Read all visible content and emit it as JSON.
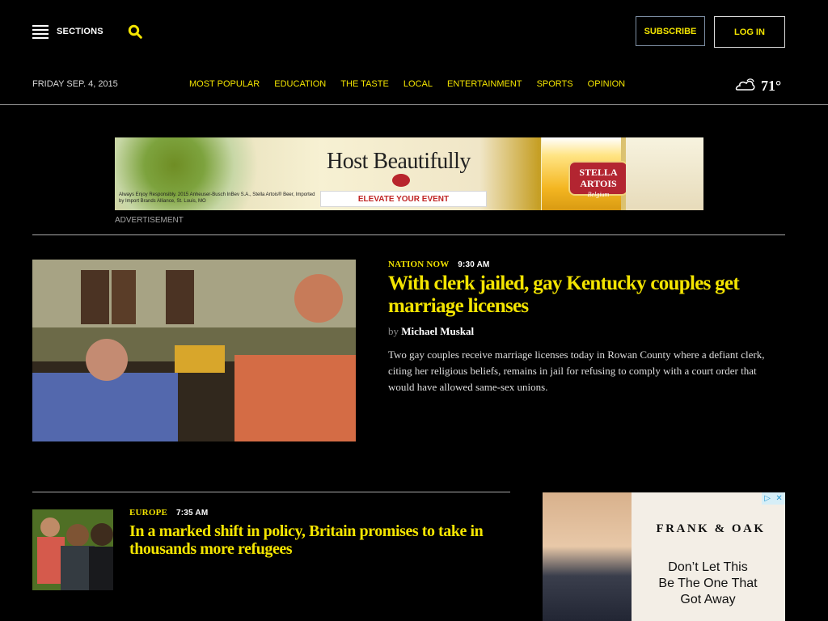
{
  "header": {
    "sections_label": "SECTIONS",
    "subscribe_label": "SUBSCRIBE",
    "login_label": "LOG IN"
  },
  "nav": {
    "date": "FRIDAY SEP. 4, 2015",
    "links": [
      "MOST POPULAR",
      "EDUCATION",
      "THE TASTE",
      "LOCAL",
      "ENTERTAINMENT",
      "SPORTS",
      "OPINION"
    ],
    "temperature": "71°",
    "weather_icon": "partly-cloudy-icon"
  },
  "ad_banner": {
    "headline": "Host Beautifully",
    "cta": "ELEVATE YOUR EVENT",
    "brand_line1": "STELLA",
    "brand_line2": "ARTOIS",
    "brand_sub": "Belgium",
    "disclaimer": "Always Enjoy Responsibly. 2015 Anheuser-Busch InBev S.A., Stella Artois® Beer, Imported by Import Brands Alliance, St. Louis, MO",
    "label": "ADVERTISEMENT"
  },
  "lead_story": {
    "section": "NATION NOW",
    "time": "9:30 AM",
    "title": "With clerk jailed, gay Kentucky couples get marriage licenses",
    "byline_prefix": "by",
    "author": "Michael Muskal",
    "summary": "Two gay couples receive marriage licenses today in Rowan County where a defiant clerk, citing her religious beliefs, remains in jail for refusing to comply with a court order that would have allowed same-sex unions."
  },
  "second_story": {
    "section": "EUROPE",
    "time": "7:35 AM",
    "title": "In a marked shift in policy, Britain promises to take in thousands more refugees"
  },
  "side_ad": {
    "brand": "FRANK & OAK",
    "copy_line1": "Don’t Let This",
    "copy_line2": "Be The One That",
    "copy_line3": "Got Away",
    "icon1": "ad-choices-icon",
    "icon2": "close-icon"
  },
  "colors": {
    "accent": "#f3e400",
    "background": "#000000"
  }
}
